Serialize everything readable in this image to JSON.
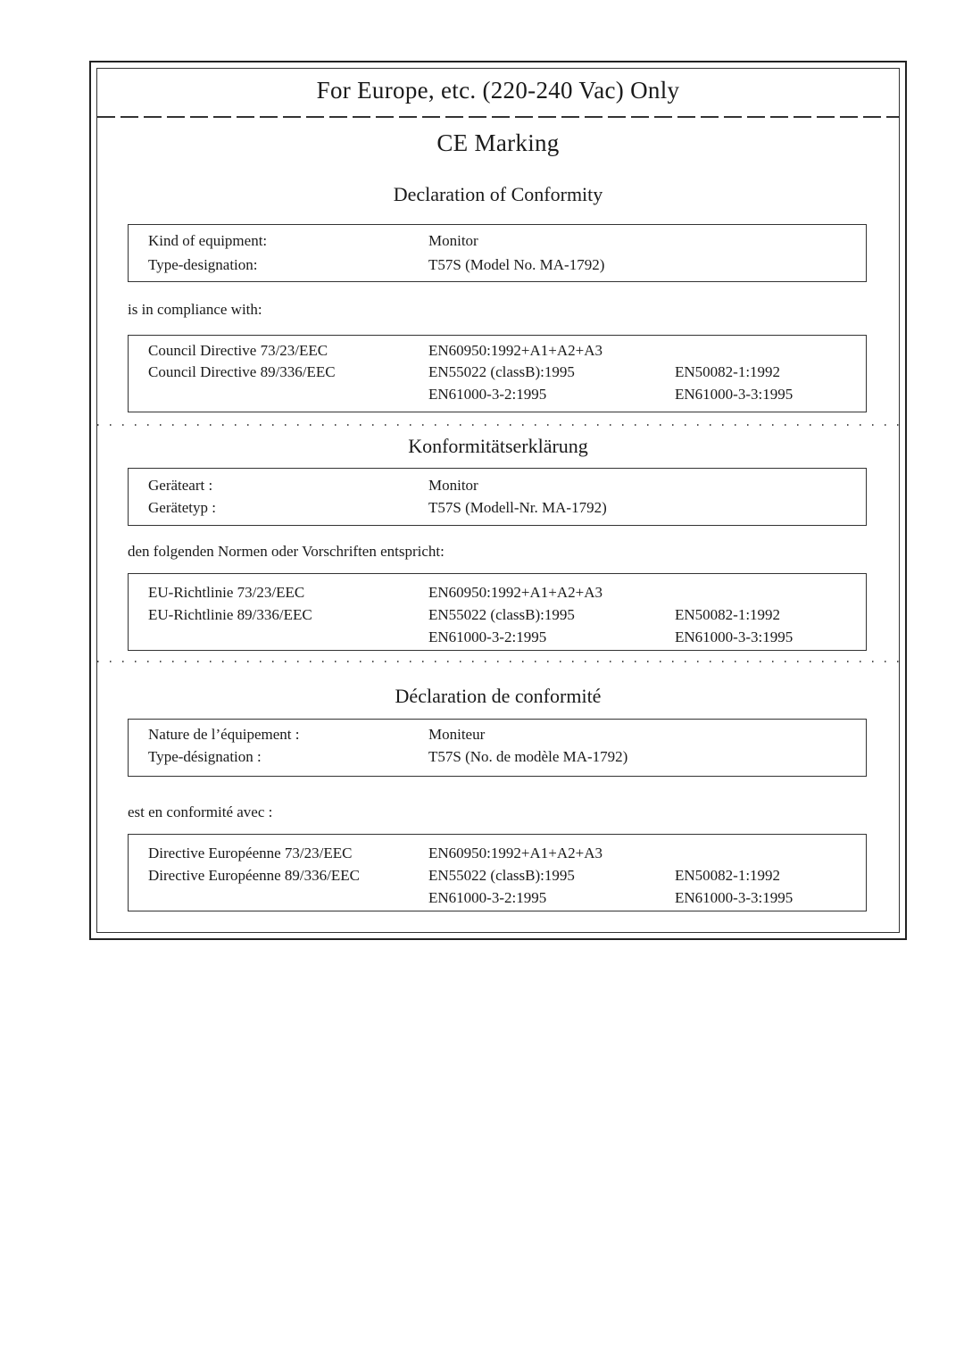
{
  "header": {
    "region_title": "For Europe, etc. (220-240 Vac) Only",
    "section_title": "CE Marking"
  },
  "english": {
    "title": "Declaration of Conformity",
    "equipment": {
      "kind_label": "Kind of equipment:",
      "kind_value": "Monitor",
      "type_label": "Type-designation:",
      "type_value": "T57S (Model No. MA-1792)"
    },
    "compliance_intro": "is in compliance with:",
    "directives": [
      {
        "name": "Council Directive 73/23/EEC",
        "standards": [
          "EN60950:1992+A1+A2+A3",
          ""
        ]
      },
      {
        "name": "Council Directive 89/336/EEC",
        "standards": [
          "EN55022 (classB):1995",
          "EN50082-1:1992"
        ]
      },
      {
        "name": "",
        "standards": [
          "EN61000-3-2:1995",
          "EN61000-3-3:1995"
        ]
      }
    ]
  },
  "german": {
    "title": "Konformitätserklärung",
    "equipment": {
      "kind_label": "Geräteart :",
      "kind_value": "Monitor",
      "type_label": "Gerätetyp :",
      "type_value": "T57S (Modell-Nr. MA-1792)"
    },
    "compliance_intro": "den folgenden Normen oder Vorschriften entspricht:",
    "directives": [
      {
        "name": "EU-Richtlinie 73/23/EEC",
        "standards": [
          "EN60950:1992+A1+A2+A3",
          ""
        ]
      },
      {
        "name": "EU-Richtlinie 89/336/EEC",
        "standards": [
          "EN55022 (classB):1995",
          "EN50082-1:1992"
        ]
      },
      {
        "name": "",
        "standards": [
          "EN61000-3-2:1995",
          "EN61000-3-3:1995"
        ]
      }
    ]
  },
  "french": {
    "title": "Déclaration de conformité",
    "equipment": {
      "kind_label": "Nature de l’équipement :",
      "kind_value": "Moniteur",
      "type_label": "Type-désignation :",
      "type_value": "T57S (No. de modèle MA-1792)"
    },
    "compliance_intro": "est en conformité avec :",
    "directives": [
      {
        "name": "Directive Européenne 73/23/EEC",
        "standards": [
          "EN60950:1992+A1+A2+A3",
          ""
        ]
      },
      {
        "name": "Directive Européenne 89/336/EEC",
        "standards": [
          "EN55022 (classB):1995",
          "EN50082-1:1992"
        ]
      },
      {
        "name": "",
        "standards": [
          "EN61000-3-2:1995",
          "EN61000-3-3:1995"
        ]
      }
    ]
  }
}
